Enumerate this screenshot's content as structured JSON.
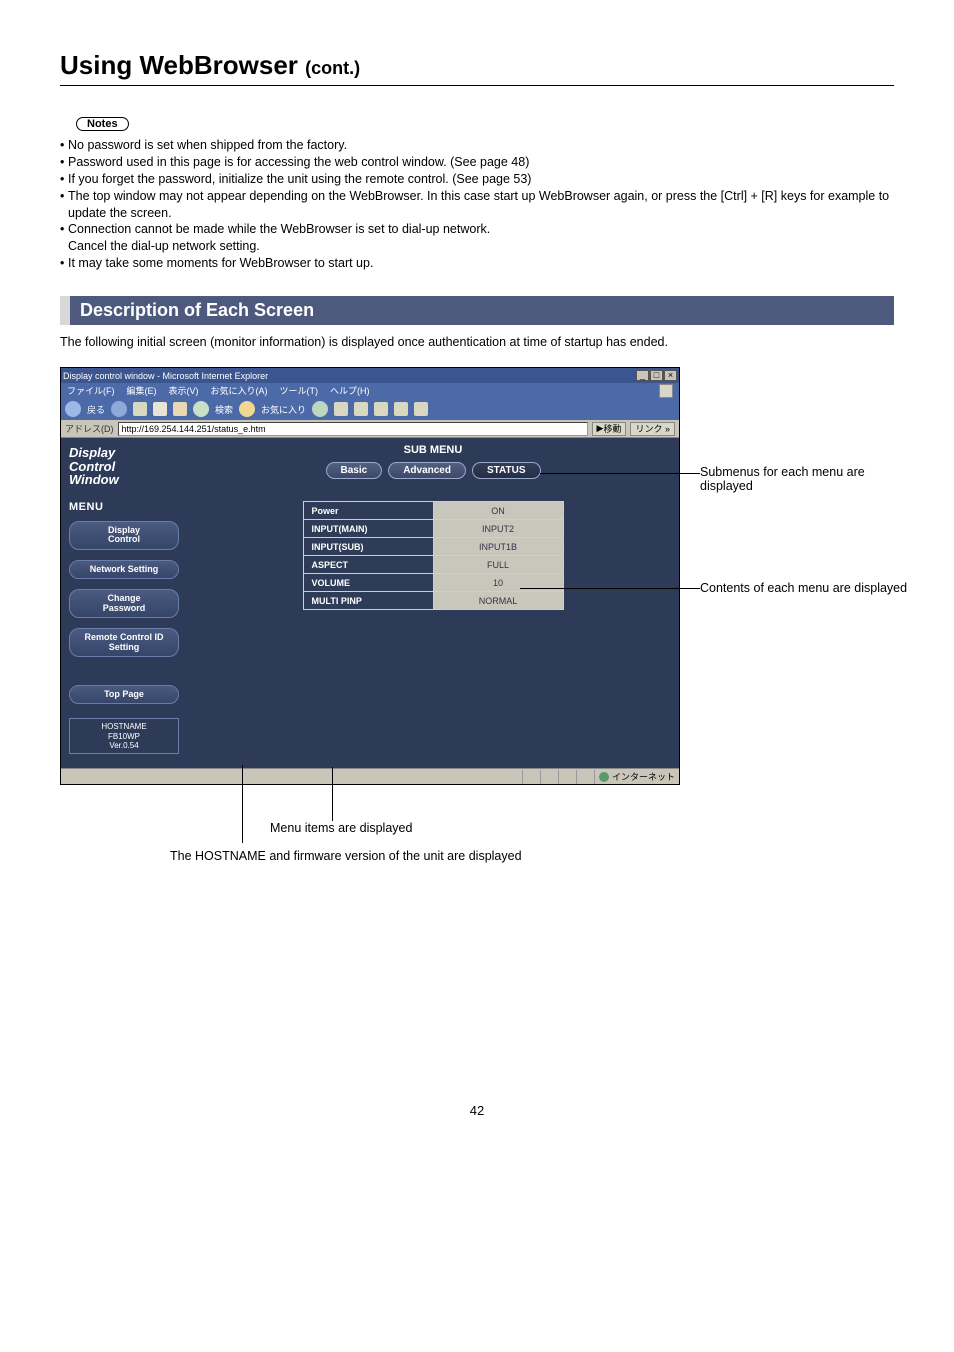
{
  "page": {
    "title_main": "Using WebBrowser",
    "title_cont": "(cont.)",
    "page_number": "42"
  },
  "notes": {
    "badge": "Notes",
    "items": [
      "No password is set when shipped from the factory.",
      "Password used in this page is for accessing the web control window. (See page 48)",
      "If you forget the password, initialize the unit using the remote control. (See page 53)",
      "The top window may not appear depending on the WebBrowser. In this case start up WebBrowser again, or press the [Ctrl] + [R] keys for example to update the screen.",
      "Connection cannot be made while the WebBrowser is set to dial-up network.",
      "It may take some moments for WebBrowser to start up."
    ],
    "sub_cancel": "Cancel the dial-up network setting."
  },
  "section": {
    "heading": "Description of Each Screen",
    "intro": "The following initial screen (monitor information) is displayed once authentication at time of startup has ended."
  },
  "browser": {
    "titlebar": "Display control window - Microsoft Internet Explorer",
    "win_min": "_",
    "win_max": "□",
    "win_close": "×",
    "menu": {
      "file": "ファイル(F)",
      "edit": "編集(E)",
      "view": "表示(V)",
      "fav": "お気に入り(A)",
      "tools": "ツール(T)",
      "help": "ヘルプ(H)"
    },
    "toolbar": {
      "back": "戻る",
      "search": "検索",
      "fav": "お気に入り"
    },
    "addr_label": "アドレス(D)",
    "addr_url": "http://169.254.144.251/status_e.htm",
    "go_label": "移動",
    "link_label": "リンク »",
    "statusbar_net": "インターネット"
  },
  "app": {
    "logo_l1": "Display",
    "logo_l2": "Control",
    "logo_l3": "Window",
    "menu_heading": "MENU",
    "side": {
      "display_control_l1": "Display",
      "display_control_l2": "Control",
      "network_setting": "Network Setting",
      "change_pw_l1": "Change",
      "change_pw_l2": "Password",
      "remote_l1": "Remote Control ID",
      "remote_l2": "Setting",
      "top_page": "Top Page"
    },
    "host": {
      "l1": "HOSTNAME",
      "l2": "FB10WP",
      "l3": "Ver.0.54"
    },
    "submenu_title": "SUB MENU",
    "tabs": {
      "basic": "Basic",
      "advanced": "Advanced",
      "status": "STATUS"
    },
    "rows": [
      {
        "label": "Power",
        "val": "ON"
      },
      {
        "label": "INPUT(MAIN)",
        "val": "INPUT2"
      },
      {
        "label": "INPUT(SUB)",
        "val": "INPUT1B"
      },
      {
        "label": "ASPECT",
        "val": "FULL"
      },
      {
        "label": "VOLUME",
        "val": "10"
      },
      {
        "label": "MULTI PINP",
        "val": "NORMAL"
      }
    ]
  },
  "callouts": {
    "submenu": "Submenus for each menu are displayed",
    "contents": "Contents of each menu are displayed",
    "menu_items": "Menu items are displayed",
    "hostname": "The HOSTNAME and firmware version of the unit are displayed"
  }
}
